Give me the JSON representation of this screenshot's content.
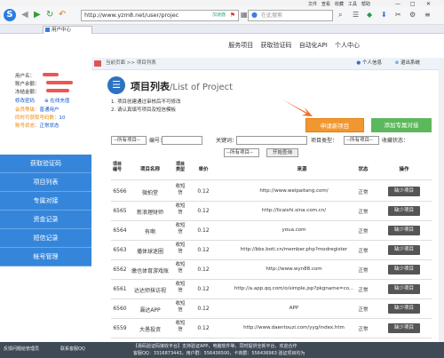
{
  "menubar": {
    "items": [
      "文件",
      "查看",
      "收藏",
      "工具",
      "帮助"
    ]
  },
  "browser": {
    "url": "http://www.yzm8.net/user/projec",
    "url_hint": "加速器",
    "search_placeholder": "在此搜索",
    "tab_title": "用户中心"
  },
  "topnav": {
    "links": [
      "服务项目",
      "获取验证码",
      "自动化API",
      "个人中心"
    ]
  },
  "crumb": {
    "path": "当前页面 >> 项目列表",
    "personal": "个人信息",
    "logout": "退出系统"
  },
  "user": {
    "name_label": "用户名：",
    "account_label": "账户余额：",
    "frozen_label": "冻结金额：",
    "modify_pwd": "修改密码",
    "online_recharge": "在线充值",
    "level_label": "会员等级：",
    "level": "普通用户",
    "concurrent_label": "同时可获取号码数：",
    "concurrent": "10",
    "status_label": "账号状态：",
    "status": "正常状态"
  },
  "sidebar": {
    "items": [
      "获取验证码",
      "项目列表",
      "专属对接",
      "资金记录",
      "短信记录",
      "帐号管理"
    ]
  },
  "page": {
    "title": "项目列表",
    "title_en": "/List of Project",
    "note1": "1. 项目创建通过审核后不可修改",
    "note2": "2. 请认真填写项目及短信模板",
    "apply_button": "申请新项目",
    "add_button": "添加专属对接"
  },
  "filter": {
    "select_all": "--所有项目--",
    "code_label": "编号：",
    "keyword_label": "关键词：",
    "type_label": "项目类型：",
    "type_all": "--所有项目--",
    "collect_label": "收藏状态：",
    "query": "开始查询"
  },
  "table": {
    "headers": [
      "项目编号",
      "项目名称",
      "项目类型",
      "单价",
      "来源",
      "状态",
      "操作"
    ],
    "rows": [
      {
        "id": "6566",
        "name": "微拍堂",
        "type": "收短信",
        "price": "0.12",
        "source": "http://www.weipaitang.com/",
        "status": "正常",
        "op": "缺少项目"
      },
      {
        "id": "6565",
        "name": "新浪理财师",
        "type": "收短信",
        "price": "0.12",
        "source": "http://licaishi.sina.com.cn/",
        "status": "正常",
        "op": "缺少项目"
      },
      {
        "id": "6564",
        "name": "有啊",
        "type": "收短信",
        "price": "0.12",
        "source": "youa.com",
        "status": "正常",
        "op": "缺少项目"
      },
      {
        "id": "6563",
        "name": "播体球迷圈",
        "type": "收短信",
        "price": "0.12",
        "source": "http://bbs.boti.cn/member.php?modregister",
        "status": "正常",
        "op": "缺少项目"
      },
      {
        "id": "6562",
        "name": "缴也体育游戏账",
        "type": "收短信",
        "price": "0.12",
        "source": "http://www.wyn88.com",
        "status": "正常",
        "op": "缺少项目"
      },
      {
        "id": "6561",
        "name": "达达师抹访视",
        "type": "收短信",
        "price": "0.12",
        "source": "http://a.app.qq.com/o/simple.jsp?pkgname=co...",
        "status": "正常",
        "op": "缺少项目"
      },
      {
        "id": "6560",
        "name": "瀛达APP",
        "type": "收短信",
        "price": "0.12",
        "source": "APP",
        "status": "正常",
        "op": "缺少项目"
      },
      {
        "id": "6559",
        "name": "大愚投资",
        "type": "收短信",
        "price": "0.12",
        "source": "http://www.daentouzi.com/yyg/index.htm",
        "status": "正常",
        "op": "缺少项目"
      }
    ]
  },
  "statusbar": {
    "left1": "反馈问题给管理员",
    "left2": "联系客服QQ",
    "right1": "【易码验证码接收平台】支持验证APP，电脑软件等，同时提供全新平台，欢迎合作",
    "right2": "客服QQ：3316873443，用户群：556436500，卡商群：556436963 验证项目均为"
  }
}
